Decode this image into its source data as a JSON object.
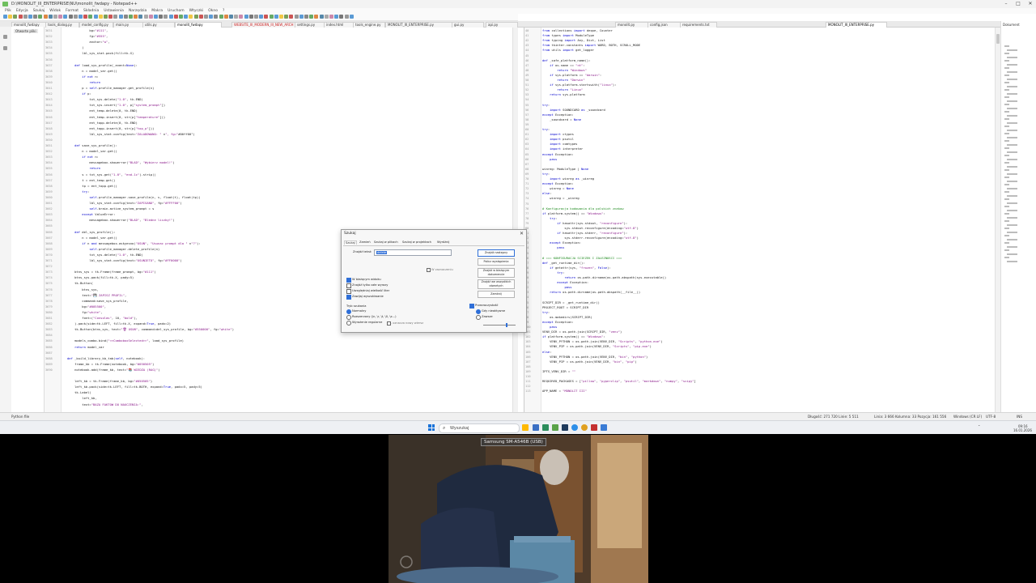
{
  "window": {
    "title": "D:\\MONOLIT_III_ENTERPRISE\\NU\\monolit_fwdapy - Notepad++",
    "minimize": "–",
    "maximize": "□",
    "close": "✕"
  },
  "menu": [
    "Plik",
    "Edycja",
    "Szukaj",
    "Widok",
    "Format",
    "Składnia",
    "Ustawienia",
    "Narzędzia",
    "Makra",
    "Uruchom",
    "Wtyczki",
    "Okno",
    "?"
  ],
  "tabs": [
    {
      "label": "monolit_fwdapy"
    },
    {
      "label": "tools_dialog.py"
    },
    {
      "label": "model_config.py"
    },
    {
      "label": "main.py"
    },
    {
      "label": "utils.py"
    },
    {
      "label": "monolit_fwdapy"
    },
    {
      "label": "WEBSITE_III_MODERN_III_NEW_ARCH"
    },
    {
      "label": "settings.py"
    },
    {
      "label": "index.html"
    },
    {
      "label": "tools_engine.py"
    },
    {
      "label": "MONOLIT_III_ENTERPRISE.py"
    },
    {
      "label": "gui.py"
    },
    {
      "label": "api.py"
    },
    {
      "label": "monolit.py"
    },
    {
      "label": "config.json"
    },
    {
      "label": "requirements.txt"
    },
    {
      "label": "MONOLIT_III_ENTERPRISE.py"
    }
  ],
  "left_panel": {
    "title": "Otwarte pliki"
  },
  "right_panel": {
    "title": "Dokument"
  },
  "left_editor": {
    "line_numbers": [
      "3631",
      "3632",
      "3633",
      "3634",
      "3635",
      "3636",
      "3637",
      "3638",
      "3639",
      "3640",
      "3641",
      "3642",
      "3643",
      "3644",
      "3645",
      "3646",
      "3647",
      "3648",
      "3649",
      "3650",
      "3651",
      "3652",
      "3653",
      "3654",
      "3655",
      "3656",
      "3657",
      "3658",
      "3659",
      "3660",
      "3661",
      "3662",
      "3663",
      "3664",
      "3665",
      "3666",
      "3667",
      "3668",
      "3669",
      "3670",
      "3671",
      "3672",
      "3673",
      "3674",
      "3675",
      "3676",
      "3677",
      "3678",
      "3679",
      "3680",
      "3681",
      "3682",
      "3683",
      "3684",
      "3685",
      "3686",
      "3687",
      "3688",
      "3689",
      "3690"
    ],
    "lines": [
      "            bg=\"#111\",",
      "            fg=\"#555\",",
      "            anchor=\"w\",",
      "        )",
      "        lbl_sys_stat.pack(fill=tk.X)",
      "",
      "    def load_sys_profile(_event=None):",
      "        n = model_var.get()",
      "        if not n:",
      "            return",
      "        p = self.profile_manager.get_profile(n)",
      "        if p:",
      "            txt_sys.delete(\"1.0\", tk.END)",
      "            txt_sys.insert(\"1.0\", p[\"system_prompt\"])",
      "            ent_temp.delete(0, tk.END)",
      "            ent_temp.insert(0, str(p[\"temperature\"]))",
      "            ent_topp.delete(0, tk.END)",
      "            ent_topp.insert(0, str(p[\"top_p\"]))",
      "            lbl_sys_stat.config(text=\"ZALADOWANO: \" n\", fg=\"#00ff00\")",
      "",
      "    def save_sys_profile():",
      "        n = model_var.get()",
      "        if not n:",
      "            messagebox.showerror(\"BLAD\", \"Wybierz model!\")",
      "            return",
      "        s = txt_sys.get(\"1.0\", \"end-1c\").strip()",
      "        t = ent_temp.get()",
      "        tp = ent_topp.get()",
      "        try:",
      "            self.profile_manager.save_profile(n, s, float(t), float(tp))",
      "            lbl_sys_stat.config(text=\"ZAPISANO\", fg=\"#FFFF00\")",
      "            self.brain.active_system_prompt = s",
      "        except ValueError:",
      "            messagebox.showerror(\"BLAD\", \"Bledne liczby!\")",
      "",
      "    def del_sys_profile():",
      "        n = model_var.get()",
      "        if n and messagebox.askyesno(\"USUN\", \"Usunac prompt dla \" n\"?\"):",
      "            self.profile_manager.delete_profile(n)",
      "            txt_sys.delete(\"1.0\", tk.END)",
      "            lbl_sys_stat.config(text=\"USUNIETO\", fg=\"#FF0000\")",
      "",
      "    btns_sys = tk.Frame(frame_prompt, bg=\"#111\")",
      "    btns_sys.pack(fill=tk.X, pady=5)",
      "    tk.Button(",
      "        btns_sys,",
      "        text=\"💾 ZAPISZ PROFIL\",",
      "        command=save_sys_profile,",
      "        bg=\"#005500\",",
      "        fg=\"white\",",
      "        font=(\"Consolas\", 10, \"bold\"),",
      "    ).pack(side=tk.LEFT, fill=tk.X, expand=True, padx=2)",
      "    tk.Button(btns_sys, text=\"🗑 USUN\", command=del_sys_profile, bg=\"#550000\", fg=\"white\")",
      "",
      "    models_combo.bind(\"<<ComboboxSelected>>\", load_sys_profile)",
      "    return model_var",
      "",
      "def _build_library_kb_tab(self, notebook):",
      "    frame_kb = tk.Frame(notebook, bg=\"#050505\")",
      "    notebook.add(frame_kb, text=\"📚 WIEDZA (RAG)\")",
      "",
      "    left_kb = tk.Frame(frame_kb, bg=\"#050505\")",
      "    left_kb.pack(side=tk.LEFT, fill=tk.BOTH, expand=True, padx=5, pady=5)",
      "    tk.Label(",
      "        left_kb,",
      "        text=\"BAZA FAKTOW DO NAUCZENIA:\","
    ]
  },
  "right_editor": {
    "line_numbers": [
      "40",
      "41",
      "42",
      "43",
      "44",
      "45",
      "46",
      "47",
      "48",
      "49",
      "50",
      "51",
      "52",
      "53",
      "54",
      "55",
      "56",
      "57",
      "58",
      "59",
      "60",
      "61",
      "62",
      "63",
      "64",
      "65",
      "66",
      "67",
      "68",
      "69",
      "70",
      "71",
      "72",
      "73",
      "74",
      "75",
      "76",
      "77",
      "78",
      "79",
      "80",
      "81",
      "82",
      "83",
      "84",
      "85",
      "86",
      "87",
      "88",
      "89",
      "90",
      "91",
      "92",
      "93",
      "94",
      "95",
      "96",
      "97",
      "98",
      "99",
      "100",
      "101",
      "102",
      "103",
      "104",
      "105",
      "106",
      "107",
      "108",
      "109",
      "110",
      "111",
      "112",
      "113",
      "114",
      "115",
      "116",
      "117"
    ],
    "lines": [
      "from collections import deque, Counter",
      "from types import ModuleType",
      "from typing import Any, Dict, List",
      "from tkinter.constants import WORD, BOTH, SCROLL_MODE",
      "from utils import get_logger",
      "",
      "def _safe_platform_name():",
      "    if os.name == \"nt\":",
      "        return \"Windows\"",
      "    if sys.platform == \"darwin\":",
      "        return \"Darwin\"",
      "    if sys.platform.startswith(\"linux\"):",
      "        return \"Linux\"",
      "    return sys.platform",
      "",
      "try:",
      "    import SOUNDCARD as _soundcard",
      "except Exception:",
      "    _soundcard = None",
      "",
      "try:",
      "    import ctypes",
      "    import psutil",
      "    import comtypes",
      "    import interpreter",
      "except Exception:",
      "    pass",
      "",
      "winreg: ModuleType | None",
      "try:",
      "    import winreg as _winreg",
      "except Exception:",
      "    winreg = None",
      "else:",
      "    winreg = _winreg",
      "",
      "# Konfiguracja kodowania dla polskich znakow",
      "if platform.system() == \"Windows\":",
      "    try:",
      "        if hasattr(sys.stdout, \"reconfigure\"):",
      "            sys.stdout.reconfigure(encoding=\"utf-8\")",
      "        if hasattr(sys.stderr, \"reconfigure\"):",
      "            sys.stderr.reconfigure(encoding=\"utf-8\")",
      "    except Exception:",
      "        pass",
      "",
      "# === KONFIGURACJA SCIEZEK I ZALEZNOSCI ===",
      "def _get_runtime_dir():",
      "    if getattr(sys, \"frozen\", False):",
      "        try:",
      "            return os.path.dirname(os.path.abspath(sys.executable))",
      "        except Exception:",
      "            pass",
      "    return os.path.dirname(os.path.abspath(__file__))",
      "",
      "SCRIPT_DIR = _get_runtime_dir()",
      "PROJECT_ROOT = SCRIPT_DIR",
      "try:",
      "    os.makedirs(SCRIPT_DIR)",
      "except Exception:",
      "    pass",
      "VENV_DIR = os.path.join(SCRIPT_DIR, \"venv\")",
      "if platform.system() == \"Windows\":",
      "    VENV_PYTHON = os.path.join(VENV_DIR, \"Scripts\", \"python.exe\")",
      "    VENV_PIP = os.path.join(VENV_DIR, \"Scripts\", \"pip.exe\")",
      "else:",
      "    VENV_PYTHON = os.path.join(VENV_DIR, \"bin\", \"python\")",
      "    VENV_PIP = os.path.join(VENV_DIR, \"bin\", \"pip\")",
      "",
      "IPTS_VENV_DIR = \"\"",
      "",
      "REQUIRED_PACKAGES = [\"pillow\", \"pyperclip\", \"psutil\", \"markdown\", \"numpy\", \"scipy\"]",
      "",
      "APP_NAME = \"MONOLIT III\""
    ]
  },
  "dialog": {
    "title": "Szukaj",
    "close": "✕",
    "tabs": [
      "Szukaj",
      "Zamień",
      "Szukaj w plikach",
      "Szukaj w projektach",
      "Wyróżnij"
    ],
    "find_label": "Znajdź tekst:",
    "find_value": "delete",
    "buttons": [
      "Znajdź następny",
      "Policz wystąpienia",
      "Znajdź w bieżącym dokumencie",
      "Znajdź we wszystkich otwartych",
      "Zamknij"
    ],
    "in_selection": "W zaznaczeniu",
    "options": [
      "W bieżącym widoku",
      "Znajdź tylko całe wyrazy",
      "Uwzględniaj wielkość liter",
      "Zawijaj wyszukiwanie"
    ],
    "search_mode_title": "Tryb szukania",
    "search_modes": [
      "Normalny",
      "Rozszerzony (\\n, \\r, \\t, \\0, \\x...)",
      "Wyrażenie regularne"
    ],
    "dot_newline": ". oznacza nowy wiersz",
    "transparency_title": "Przezroczystość",
    "transparency_modes": [
      "Gdy nieaktywne",
      "Zawsze"
    ]
  },
  "statusbar": {
    "left": "Python file",
    "length": "Długość: 271 720    Linie: 5 511",
    "position": "Linia: 3 666    Kolumna: 33    Pozycja: 161 556",
    "eol": "Windows (CR LF)",
    "encoding": "UTF-8",
    "mode": "INS"
  },
  "taskbar": {
    "search_label": "Wyszukaj",
    "time": "09:16",
    "date": "16.01.2026"
  },
  "webcam": {
    "label": "Samsung SM-A546B (USB)"
  },
  "colors": {
    "keyword": "#0000cc",
    "string": "#8a1a8a",
    "comment": "#1f8b1f",
    "accent": "#2f6fd8"
  }
}
